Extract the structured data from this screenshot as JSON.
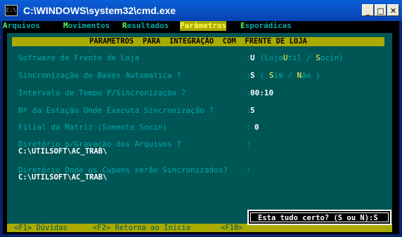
{
  "window": {
    "title": "C:\\WINDOWS\\system32\\cmd.exe",
    "icon": "cmd-icon",
    "icon_text": "C:\\",
    "buttons": {
      "minimize": "_",
      "maximize": "□",
      "close": "✕"
    }
  },
  "menu": [
    {
      "hk": "A",
      "rest": "rquivos"
    },
    {
      "hk": "M",
      "rest": "ovimentos"
    },
    {
      "hk": "R",
      "rest": "esultados"
    },
    {
      "hk": "P",
      "rest": "arâmetros",
      "active": true
    },
    {
      "hk": "E",
      "rest": "sporádicas"
    }
  ],
  "panel": {
    "title": "PARAMETROS  PARA  INTEGRAÇÃO  COM  FRENTE DE LOJA",
    "fields": [
      {
        "label": "Software de Frente de Loja",
        "value": "U",
        "hint": {
          "pre": " (Loja",
          "hk1": "U",
          "mid1": "til / ",
          "hk2": "S",
          "post": "ocin)"
        }
      },
      {
        "label": "Sincronização de Bases Automatica ?",
        "value": "S",
        "hint": {
          "pre": " ( ",
          "hk1": "S",
          "mid1": "im / ",
          "hk2": "N",
          "post": "ão )"
        }
      },
      {
        "label": "Intervalo de Tempo P/Sincronização ?",
        "value": "00:10"
      },
      {
        "label": "Nº da Estação Onde Executa Sincronização ?",
        "value": "5"
      },
      {
        "label": "Filial da Matriz (Somente Socin)",
        "value": "0"
      },
      {
        "label": "Diretório p/Gravação dos Arquivos ?",
        "value": "C:\\UTILSOFT\\AC_TRAB\\"
      },
      {
        "label": "Diretório Onde os Cupons serão Sincronizados?",
        "value": "C:\\UTILSOFT\\AC_TRAB\\"
      }
    ]
  },
  "footer": {
    "f1": "<F1> Dúvidas",
    "f2": "<F2> Retorna ao Inicio",
    "f10": "<F10>"
  },
  "confirm": {
    "prompt": "Esta tudo certo? (S ou N):",
    "value": "S"
  },
  "colors": {
    "console_bg": "#000000",
    "panel_bg": "#005555",
    "label": "#00aaaa",
    "value": "#ffffff",
    "highlight_bar": "#aaaa00",
    "hotkey": "#ffff55"
  }
}
